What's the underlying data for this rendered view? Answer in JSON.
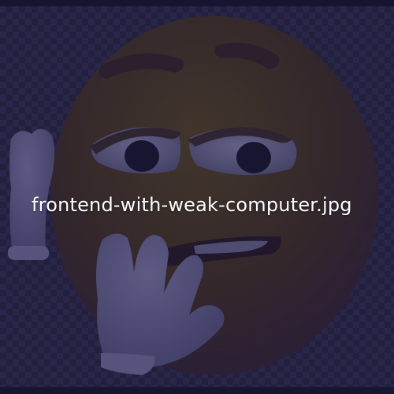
{
  "viewer": {
    "filename": "frontend-with-weak-computer.jpg"
  },
  "image": {
    "subject": "thinking-emoji",
    "colors": {
      "face": "#4a3d2a",
      "face_shade": "#3b2a33",
      "hand": "#6f6d9a",
      "eye_white": "#7b7aa2",
      "pupil": "#1a1830",
      "brow": "#3a2a30",
      "background_dark": "#2a2946",
      "background_light": "#34335a"
    }
  }
}
